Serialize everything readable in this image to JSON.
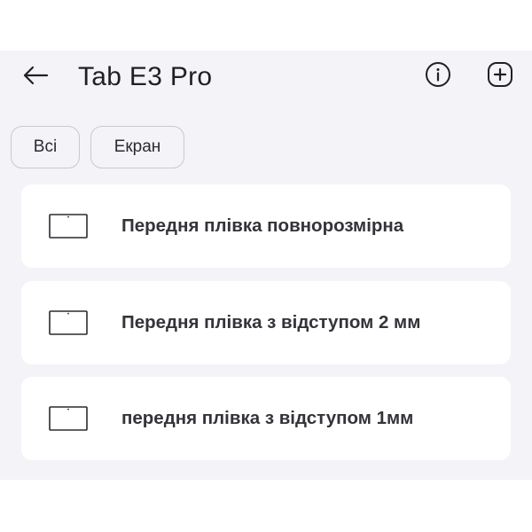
{
  "header": {
    "title": "Tab E3 Pro",
    "back_icon": "arrow-left-icon",
    "info_icon": "info-circle-icon",
    "add_icon": "plus-square-icon"
  },
  "filters": [
    {
      "label": "Всі"
    },
    {
      "label": "Екран"
    }
  ],
  "items": [
    {
      "label": "Передня плівка повнорозмірна",
      "icon": "tablet-icon"
    },
    {
      "label": "Передня плівка з відступом 2 мм",
      "icon": "tablet-icon"
    },
    {
      "label": "передня плівка з відступом 1мм",
      "icon": "tablet-icon"
    }
  ],
  "colors": {
    "background": "#f3f3f8",
    "card": "#ffffff",
    "text": "#1f1f24",
    "chip_border": "#c9c9ce"
  }
}
